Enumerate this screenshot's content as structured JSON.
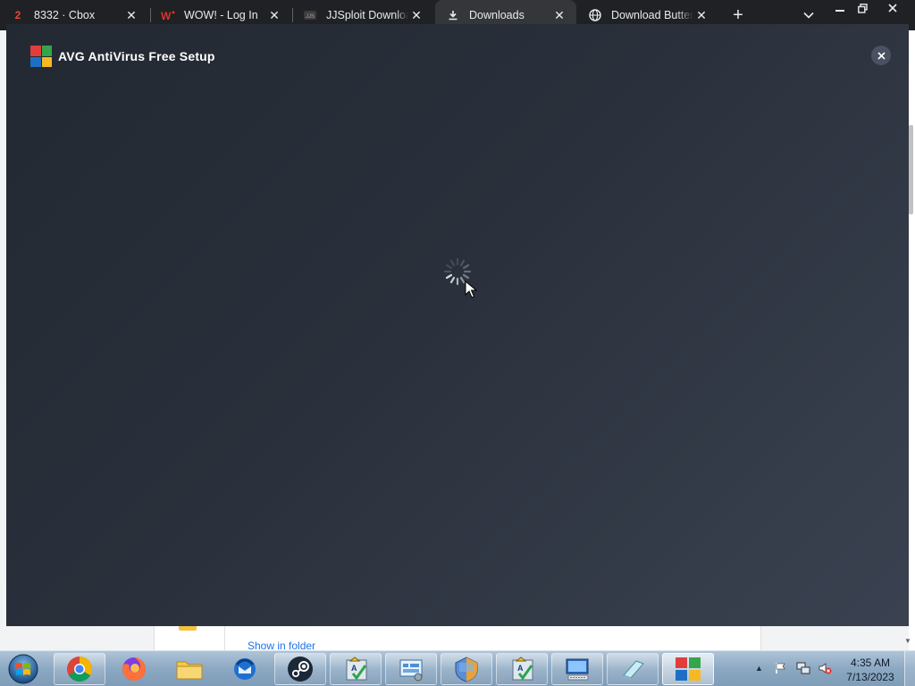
{
  "browser": {
    "tabs": [
      {
        "badge": "2",
        "title": "8332 · Cbox",
        "icon": "cbox-favicon"
      },
      {
        "title": "WOW! - Log In",
        "icon": "wow-favicon"
      },
      {
        "title": "JJSploit Download",
        "icon": "jjsploit-favicon"
      },
      {
        "title": "Downloads",
        "icon": "download-icon",
        "active": true
      },
      {
        "title": "Download Butterfly",
        "icon": "globe-icon"
      }
    ],
    "new_tab_label": "+",
    "tab_search_icon": "chevron-down-icon",
    "window_controls": [
      "minimize-icon",
      "restore-icon",
      "close-icon"
    ]
  },
  "background_page": {
    "show_in_folder": "Show in folder"
  },
  "dialog": {
    "title": "AVG AntiVirus Free Setup",
    "close_icon": "close-icon",
    "state": "loading",
    "colors": {
      "bg_start": "#232932",
      "bg_end": "#3a4251"
    }
  },
  "taskbar": {
    "pinned": [
      "chrome-icon",
      "firefox-icon",
      "file-explorer-icon",
      "thunderbird-icon",
      "steam-icon",
      "checklist-app-icon",
      "control-panel-icon",
      "windows-security-icon",
      "checklist-app-icon-2",
      "remote-desktop-icon",
      "notepad-icon",
      "avg-setup-icon"
    ],
    "tray_icons": [
      "show-hidden-icons-icon",
      "action-center-flag-icon",
      "network-icon",
      "volume-muted-icon"
    ],
    "clock": {
      "time": "4:35 AM",
      "date": "7/13/2023"
    }
  }
}
